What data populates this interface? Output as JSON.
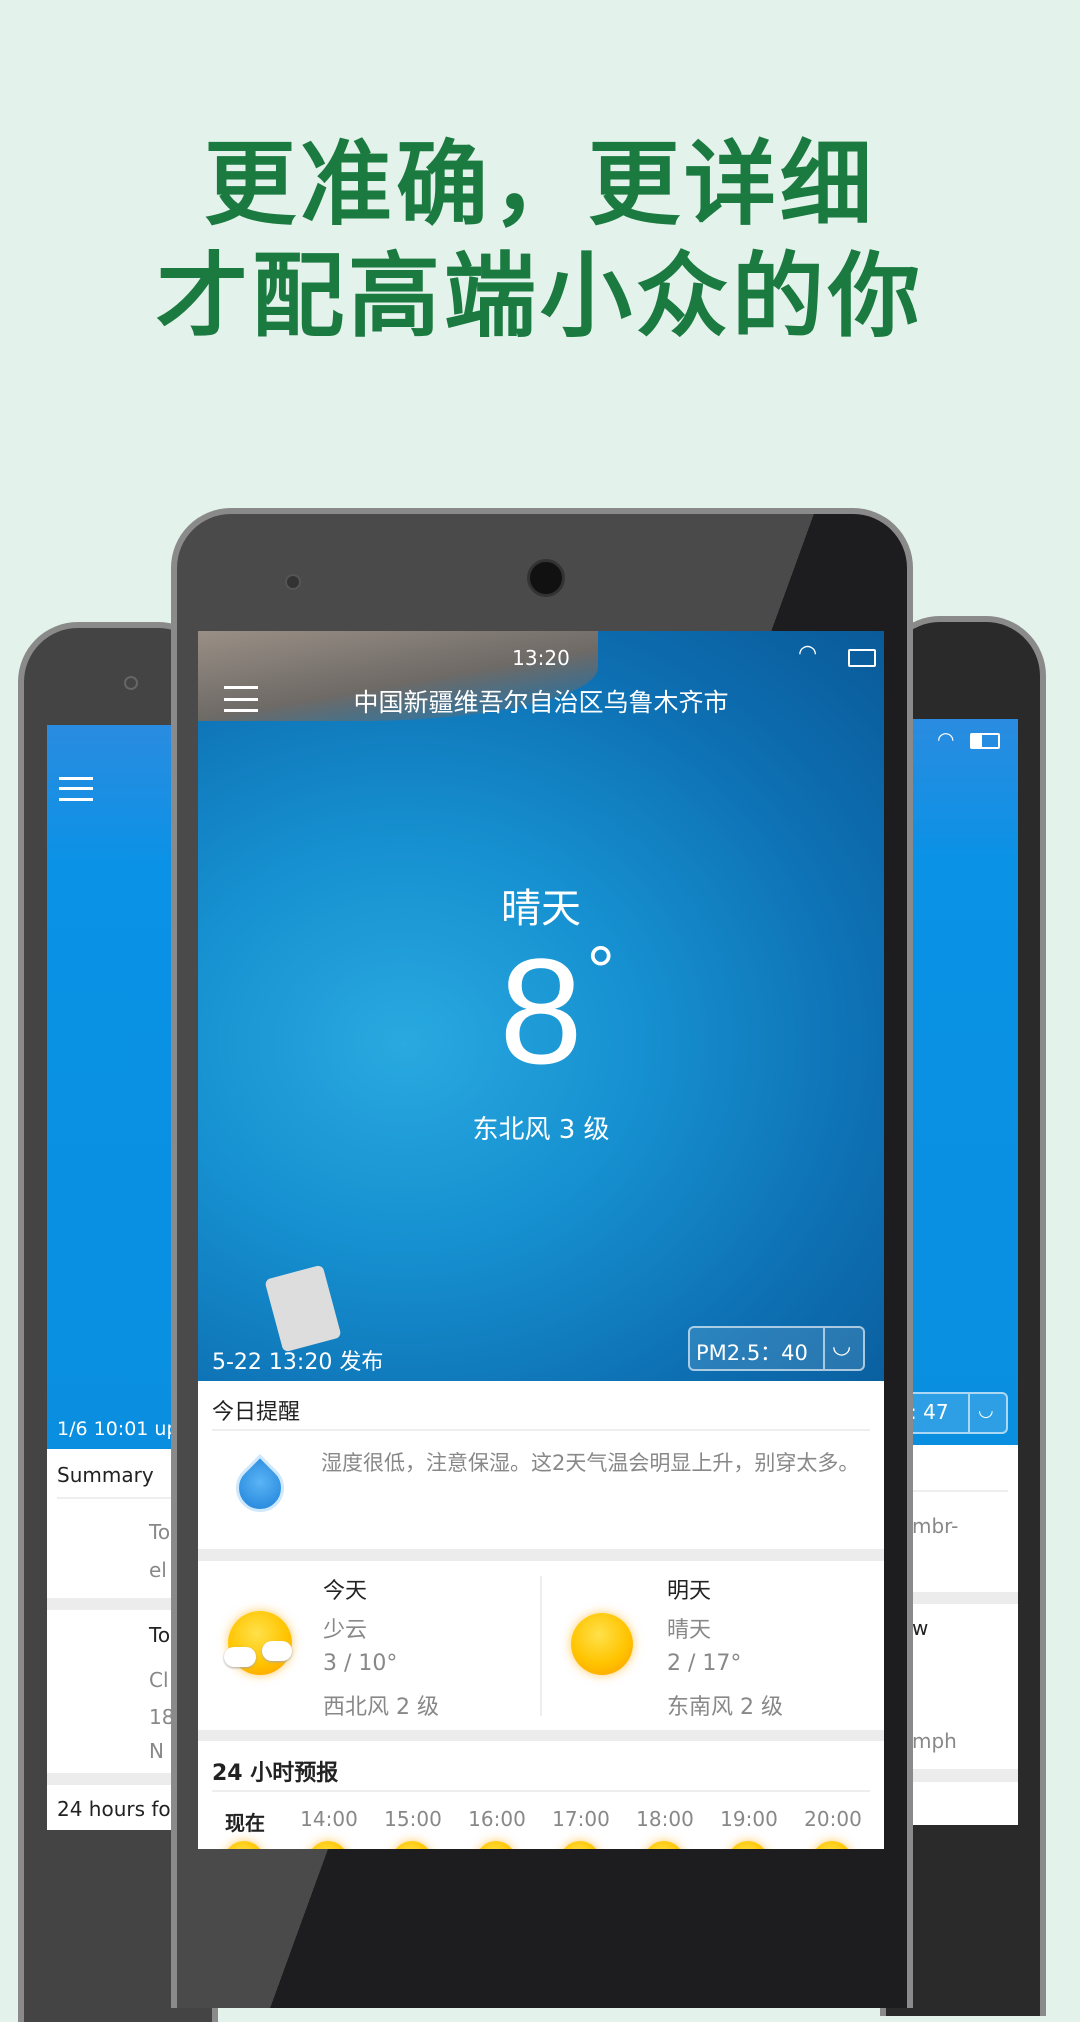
{
  "headline": {
    "line1": "更准确，更详细",
    "line2": "才配高端小众的你"
  },
  "left_phone": {
    "update_text": "1/6 10:01 up",
    "summary_label": "Summary",
    "summary_text": [
      "To",
      "el"
    ],
    "today": [
      "To",
      "Cl",
      "18",
      "N"
    ],
    "forecast_label": "24 hours fo"
  },
  "right_phone": {
    "pm_value": ": 47",
    "lines": [
      "mbr-",
      "w",
      "mph"
    ]
  },
  "status_bar": {
    "time": "13:20",
    "icons": [
      "wifi-icon",
      "battery-charging-icon"
    ]
  },
  "header": {
    "location": "中国新疆维吾尔自治区乌鲁木齐市",
    "menu_icon": "hamburger-icon"
  },
  "current": {
    "condition": "晴天",
    "temperature": "8",
    "degree": "°",
    "wind": "东北风 3 级",
    "published": "5-22 13:20 发布",
    "pm25": "PM2.5：40",
    "pm_icon": "smiley-icon"
  },
  "reminder": {
    "title": "今日提醒",
    "icon": "water-drop-icon",
    "text": "湿度很低，注意保湿。这2天气温会明显上升，别穿太多。"
  },
  "days": [
    {
      "label": "今天",
      "condition": "少云",
      "temps": "3 / 10°",
      "wind": "西北风 2 级",
      "icon": "partly-cloudy-icon"
    },
    {
      "label": "明天",
      "condition": "晴天",
      "temps": "2 / 17°",
      "wind": "东南风 2 级",
      "icon": "sunny-icon"
    }
  ],
  "hourly": {
    "title": "24 小时预报",
    "hours": [
      "现在",
      "14:00",
      "15:00",
      "16:00",
      "17:00",
      "18:00",
      "19:00",
      "20:00"
    ]
  },
  "colors": {
    "headline": "#1a7a40",
    "background": "#e3f2ea",
    "app_blue": "#0a8fe0"
  }
}
